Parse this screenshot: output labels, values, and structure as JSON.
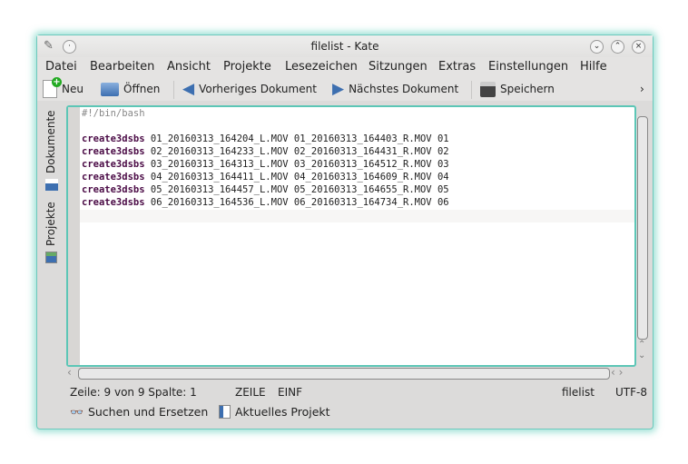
{
  "window": {
    "title": "filelist - Kate"
  },
  "menu": [
    "Datei",
    "Bearbeiten",
    "Ansicht",
    "Projekte",
    "Lesezeichen",
    "Sitzungen",
    "Extras",
    "Einstellungen",
    "Hilfe"
  ],
  "toolbar": {
    "new": "Neu",
    "open": "Öffnen",
    "prev": "Vorheriges Dokument",
    "next": "Nächstes Dokument",
    "save": "Speichern",
    "more": "›"
  },
  "side_tabs": {
    "documents": "Dokumente",
    "projects": "Projekte"
  },
  "editor": {
    "shebang": "#!/bin/bash",
    "lines": [
      {
        "cmd": "create3dsbs",
        "args": " 01_20160313_164204_L.MOV 01_20160313_164403_R.MOV 01"
      },
      {
        "cmd": "create3dsbs",
        "args": " 02_20160313_164233_L.MOV 02_20160313_164431_R.MOV 02"
      },
      {
        "cmd": "create3dsbs",
        "args": " 03_20160313_164313_L.MOV 03_20160313_164512_R.MOV 03"
      },
      {
        "cmd": "create3dsbs",
        "args": " 04_20160313_164411_L.MOV 04_20160313_164609_R.MOV 04"
      },
      {
        "cmd": "create3dsbs",
        "args": " 05_20160313_164457_L.MOV 05_20160313_164655_R.MOV 05"
      },
      {
        "cmd": "create3dsbs",
        "args": " 06_20160313_164536_L.MOV 06_20160313_164734_R.MOV 06"
      }
    ]
  },
  "status": {
    "position": "Zeile: 9 von 9 Spalte: 1",
    "mode": "ZEILE",
    "insert": "EINF",
    "filename": "filelist",
    "encoding": "UTF-8"
  },
  "bottom": {
    "search": "Suchen und Ersetzen",
    "project": "Aktuelles Projekt"
  }
}
